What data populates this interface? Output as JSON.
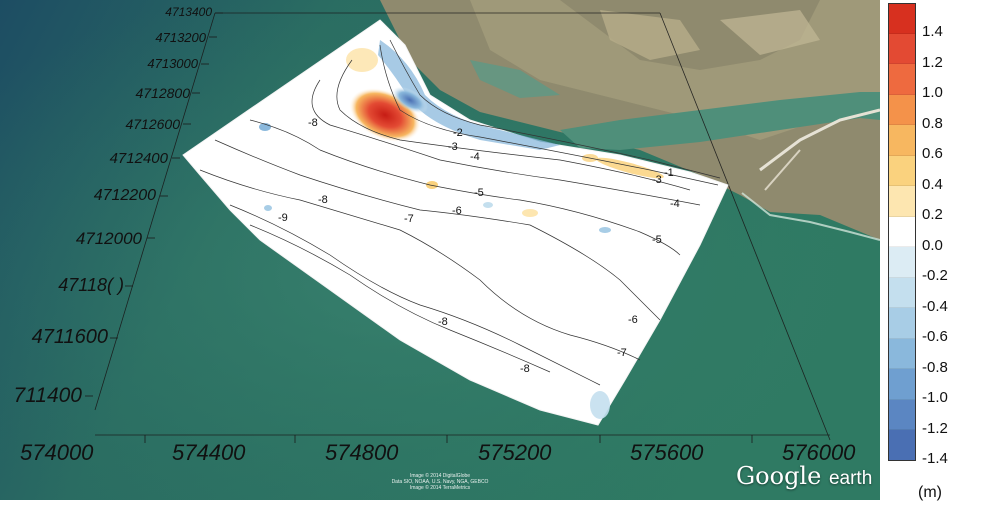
{
  "map": {
    "y_axis_labels": [
      "4713400",
      "4713200",
      "4713000",
      "4712800",
      "4712600",
      "4712400",
      "4712200",
      "4712000",
      "47118(  )",
      "4711600",
      "711400"
    ],
    "x_axis_labels": [
      "574000",
      "574400",
      "574800",
      "575200",
      "575600",
      "576000"
    ],
    "contour_labels": [
      "-1",
      "-2",
      "-3",
      "-4",
      "-5",
      "-6",
      "-7",
      "-8",
      "-9",
      "-1",
      "-2",
      "-3",
      "-4",
      "-5",
      "-6",
      "-7",
      "-8"
    ],
    "attribution": [
      "Image © 2014 DigitalGlobe",
      "Data SIO, NOAA, U.S. Navy, NGA, GEBCO",
      "Image © 2014 TerraMetrics"
    ],
    "logo": {
      "google": "Google",
      "earth": "earth"
    },
    "colors": {
      "sea": "#2f7a63",
      "deep_sea": "#1d4d63",
      "land": "#8f8a6e",
      "river": "#4f8f7a",
      "overlay": "#ffffff"
    }
  },
  "legend": {
    "labels": [
      "1.4",
      "1.2",
      "1.0",
      "0.8",
      "0.6",
      "0.4",
      "0.2",
      "0.0",
      "-0.2",
      "-0.4",
      "-0.6",
      "-0.8",
      "-1.0",
      "-1.2",
      "-1.4"
    ],
    "colors": [
      "#d7301f",
      "#e34a33",
      "#ee6a3f",
      "#f4924a",
      "#f7b760",
      "#fad27e",
      "#fde6b0",
      "#ffffff",
      "#dcecf4",
      "#c4dfee",
      "#a8cde6",
      "#8ab8dc",
      "#6f9fd0",
      "#5b86c2",
      "#4a6fb3"
    ],
    "unit": "(m)"
  }
}
